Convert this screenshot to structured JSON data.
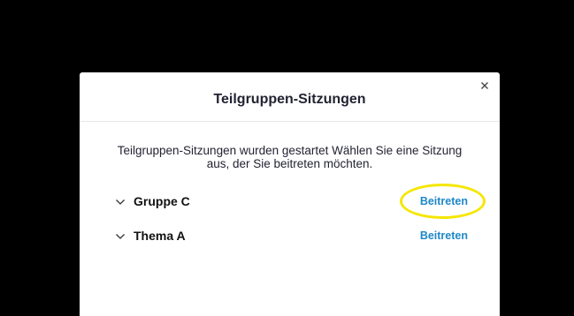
{
  "dialog": {
    "title": "Teilgruppen-Sitzungen",
    "close_icon": "close-icon",
    "message": "Teilgruppen-Sitzungen wurden gestartet Wählen Sie eine Sitzung aus, der Sie beitreten möchten."
  },
  "sessions": [
    {
      "name": "Gruppe C",
      "join_label": "Beitreten",
      "expand_icon": "chevron-down-icon"
    },
    {
      "name": "Thema A",
      "join_label": "Beitreten",
      "expand_icon": "chevron-down-icon"
    }
  ],
  "colors": {
    "backdrop": "#000000",
    "dialog_background": "#ffffff",
    "link": "#1e88c8",
    "annotation": "#f5e600"
  }
}
